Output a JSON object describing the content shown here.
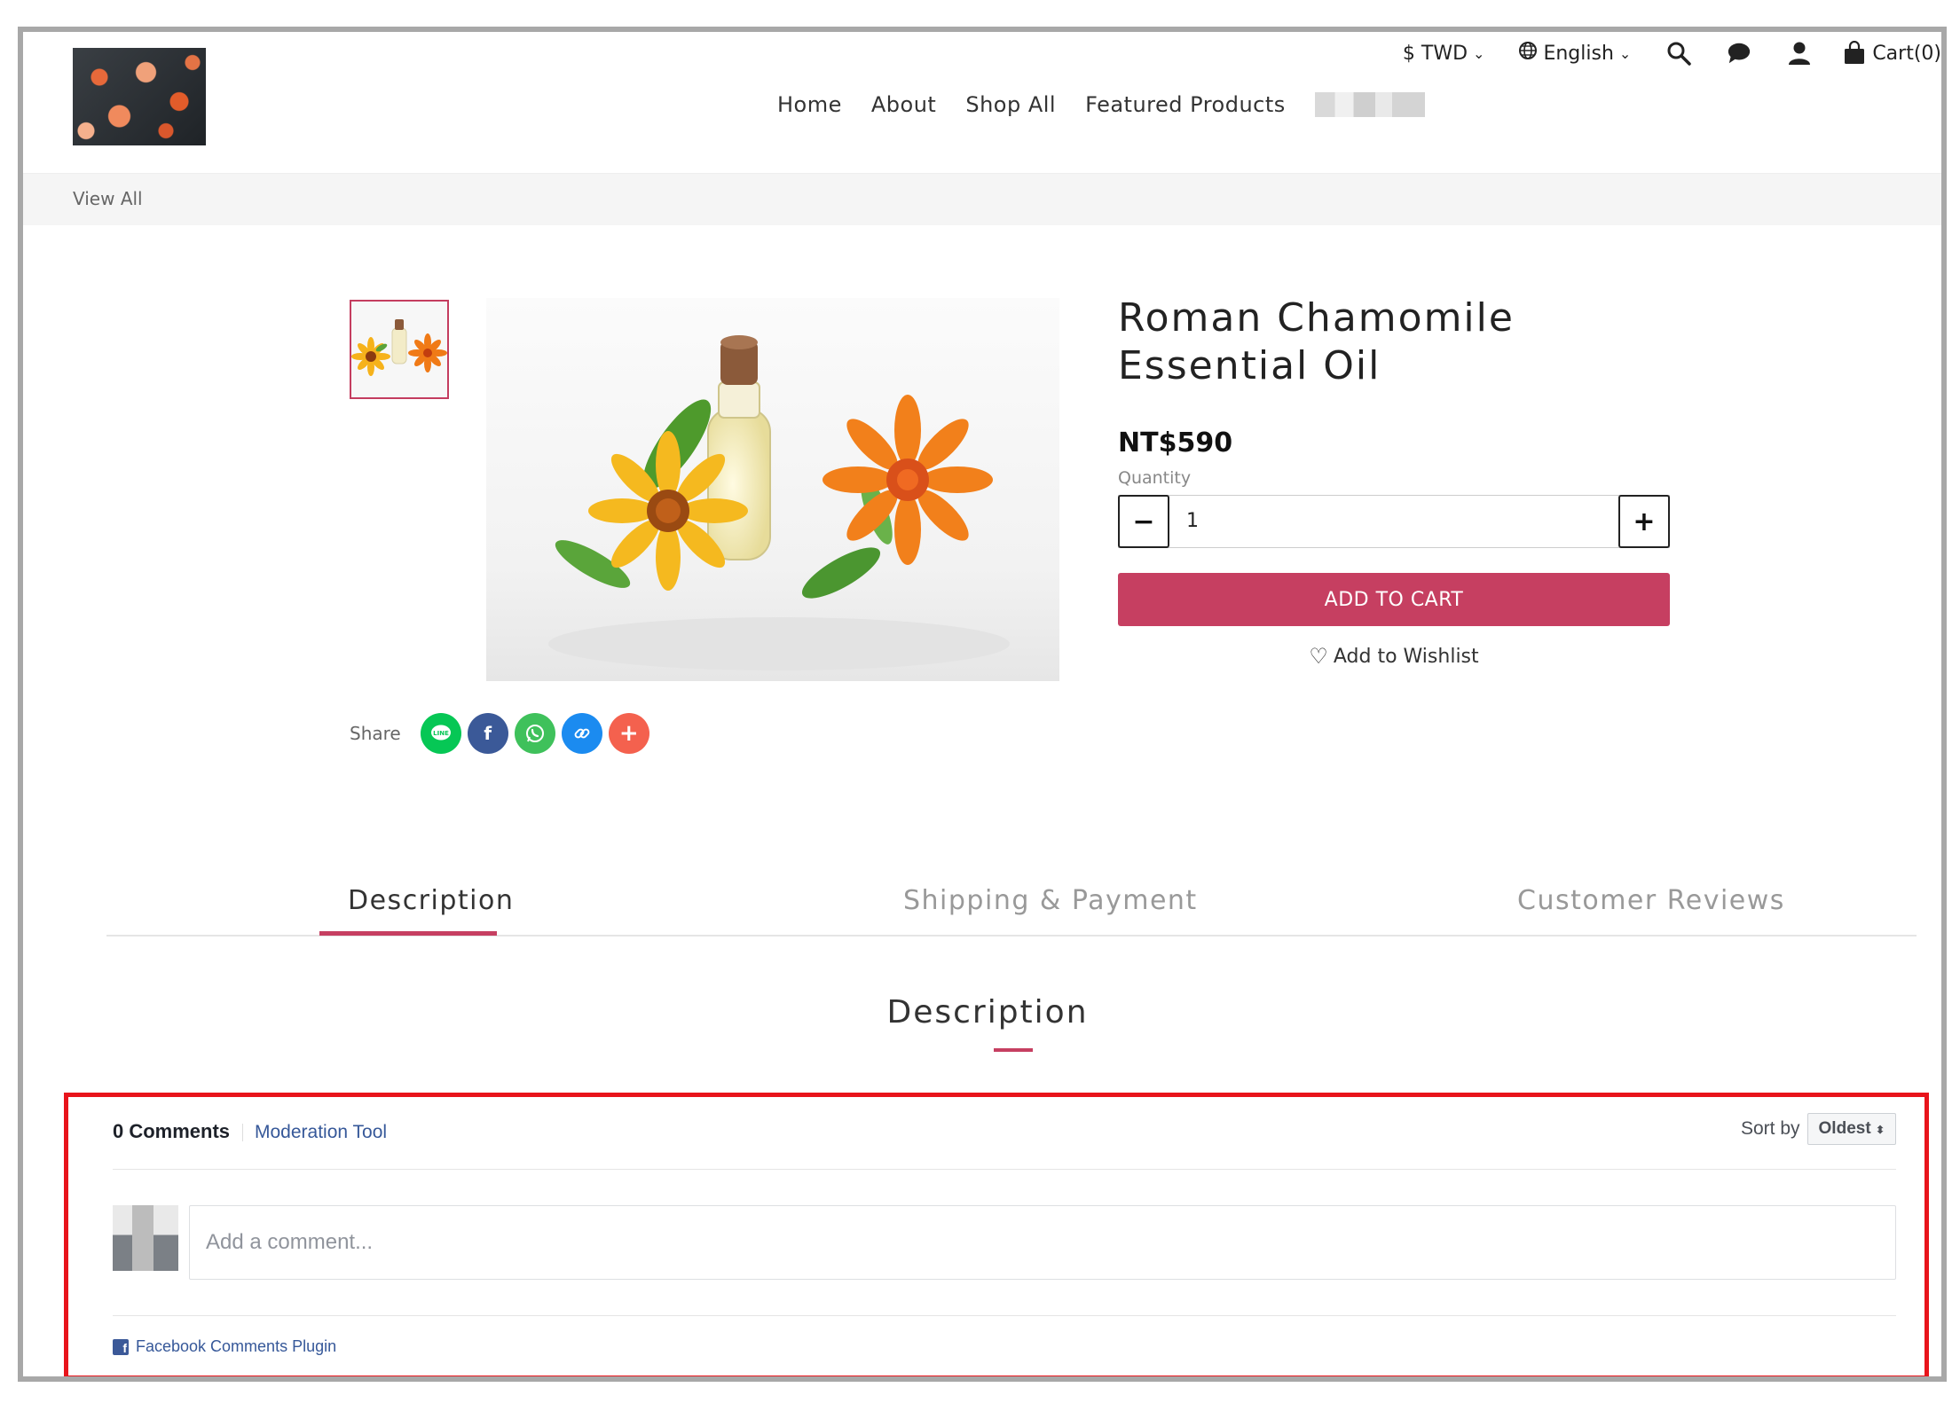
{
  "header": {
    "currency": "$ TWD",
    "language": "English",
    "cart_label": "Cart(0)",
    "nav": [
      "Home",
      "About",
      "Shop All",
      "Featured Products"
    ]
  },
  "breadcrumb": {
    "view_all": "View All"
  },
  "product": {
    "title_line1": "Roman Chamomile",
    "title_line2": "Essential Oil",
    "price": "NT$590",
    "quantity_label": "Quantity",
    "quantity_value": "1",
    "add_to_cart": "ADD TO CART",
    "wishlist": "Add to Wishlist",
    "share_label": "Share"
  },
  "tabs": {
    "items": [
      "Description",
      "Shipping & Payment",
      "Customer Reviews"
    ],
    "active": "Description"
  },
  "section": {
    "title": "Description"
  },
  "comments": {
    "count": "0 Comments",
    "moderation": "Moderation Tool",
    "sort_by": "Sort by",
    "sort_value": "Oldest",
    "placeholder": "Add a comment...",
    "plugin": "Facebook Comments Plugin"
  },
  "colors": {
    "accent": "#c63f61",
    "highlight_border": "#e8141b",
    "fb_link": "#365899"
  }
}
